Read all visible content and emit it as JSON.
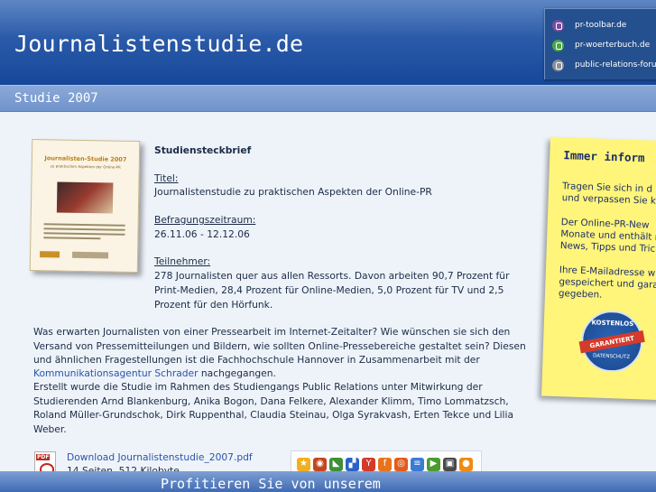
{
  "header": {
    "title": "Journalistenstudie.de",
    "links": [
      {
        "label": "pr-toolbar.de",
        "icon": "toolbar-logo-icon",
        "color": "#7a4da0"
      },
      {
        "label": "pr-woerterbuch.de",
        "icon": "woerterbuch-logo-icon",
        "color": "#4aa844"
      },
      {
        "label": "public-relations-forum",
        "icon": "forum-logo-icon",
        "color": "#8a8f99"
      }
    ]
  },
  "subbar": {
    "title": "Studie 2007"
  },
  "book": {
    "title": "Journalisten-Studie 2007",
    "subtitle": "zu praktischen Aspekten der Online-PR"
  },
  "steckbrief": {
    "heading": "Studiensteckbrief",
    "titel_label": "Titel:",
    "titel_value": "Journalistenstudie zu praktischen Aspekten der Online-PR",
    "zeitraum_label": "Befragungszeitraum:",
    "zeitraum_value": "26.11.06 - 12.12.06",
    "teilnehmer_label": "Teilnehmer:",
    "teilnehmer_lines": [
      "278 Journalisten quer aus allen Ressorts. Davon arbeiten 90,7 Prozent für",
      "Print-Medien, 28,4 Prozent für Online-Medien, 5,0 Prozent für TV und 2,5",
      "Prozent für den Hörfunk."
    ]
  },
  "body": {
    "p1_lines": [
      "Was erwarten Journalisten von einer Pressearbeit im Internet-Zeitalter? Wie wünschen sie sich den",
      "Versand von Pressemitteilungen und Bildern, wie sollten Online-Pressebereiche gestaltet sein? Diesen",
      "und ähnlichen Fragestellungen ist die Fachhochschule Hannover in Zusammenarbeit mit der"
    ],
    "link": "Kommunikationsagentur Schrader",
    "link_suffix": " nachgegangen.",
    "p2_lines": [
      "Erstellt wurde die Studie im Rahmen des Studiengangs Public Relations unter Mitwirkung der",
      "Studierenden Arnd Blankenburg, Anika Bogon, Dana Felkere, Alexander Klimm, Timo Lommatzsch,",
      "Roland Müller-Grundschok, Dirk Ruppenthal, Claudia Steinau, Olga Syrakvash, Erten Tekce und Lilia",
      "Weber."
    ]
  },
  "download": {
    "label": "Download Journalistenstudie_2007.pdf",
    "meta": "14 Seiten, 512 Kilobyte"
  },
  "note": {
    "title": "Immer inform",
    "p1": "Tragen Sie sich in d\nund verpassen Sie k",
    "p2": "Der Online-PR-New\nMonate und enthält r\nNews, Tipps und Tric",
    "p3": "Ihre E-Mailadresse w\ngespeichert und gara\ngegeben.",
    "seal_top": "KOSTENLOS",
    "seal_band": "GARANTIERT",
    "seal_bottom": "DATENSCHUTZ"
  },
  "toolbar": {
    "buttons": [
      {
        "name": "favorite-star-icon",
        "glyph": "★",
        "color": "#f2b01e"
      },
      {
        "name": "social-bookmark-icon",
        "glyph": "◉",
        "color": "#c2461f"
      },
      {
        "name": "bookmark-icon",
        "glyph": "◣",
        "color": "#3f8f3a"
      },
      {
        "name": "delicious-icon",
        "glyph": "▞",
        "color": "#2a62c9"
      },
      {
        "name": "yahoo-icon",
        "glyph": "Y",
        "color": "#d23a2a"
      },
      {
        "name": "facebook-icon",
        "glyph": "f",
        "color": "#e7731c"
      },
      {
        "name": "furl-icon",
        "glyph": "◎",
        "color": "#e25c1c"
      },
      {
        "name": "blinklist-icon",
        "glyph": "≡",
        "color": "#3a7bd5"
      },
      {
        "name": "play-icon",
        "glyph": "▶",
        "color": "#4a9c2f"
      },
      {
        "name": "mister-wong-icon",
        "glyph": "▣",
        "color": "#4a4a4a"
      },
      {
        "name": "stumble-icon",
        "glyph": "●",
        "color": "#f08a10"
      }
    ]
  },
  "footer": {
    "text": "Profitieren Sie von unserem"
  }
}
